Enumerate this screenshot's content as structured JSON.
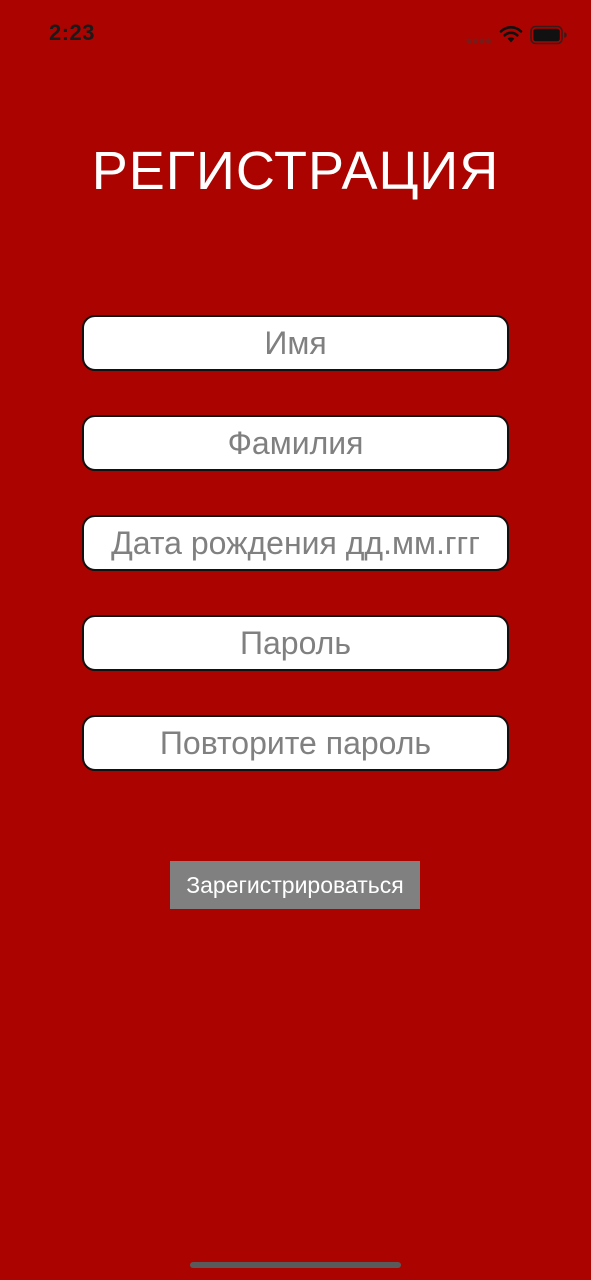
{
  "status_bar": {
    "time": "2:23"
  },
  "form": {
    "title": "РЕГИСТРАЦИЯ",
    "fields": [
      {
        "placeholder": "Имя",
        "value": ""
      },
      {
        "placeholder": "Фамилия",
        "value": ""
      },
      {
        "placeholder": "Дата рождения дд.мм.ггг",
        "value": ""
      },
      {
        "placeholder": "Пароль",
        "value": ""
      },
      {
        "placeholder": "Повторите пароль",
        "value": ""
      }
    ],
    "submit_label": "Зарегистрироваться"
  },
  "colors": {
    "background": "#ab0400",
    "button": "#808080",
    "field_background": "#ffffff",
    "field_border": "#111111",
    "placeholder": "#808080"
  },
  "icons": [
    "cellular-signal-icon",
    "wifi-icon",
    "battery-icon"
  ]
}
